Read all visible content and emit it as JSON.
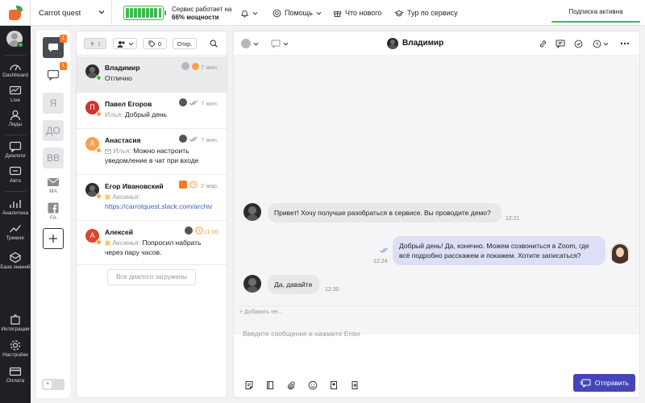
{
  "topbar": {
    "workspace": "Carrot quest",
    "service_line1": "Сервис работает на",
    "service_power": "66% мощности",
    "help": "Помощь",
    "whats_new": "Что нового",
    "tour": "Тур по сервису",
    "subscription": "Подписка активна",
    "battery_fraction": 0.66
  },
  "leftnav": {
    "items": [
      {
        "label": "Dashboard",
        "icon": "dashboard-icon"
      },
      {
        "label": "Live",
        "icon": "live-icon"
      },
      {
        "label": "Лиды",
        "icon": "leads-icon"
      },
      {
        "label": "Диалоги",
        "icon": "dialogs-icon"
      },
      {
        "label": "Авто",
        "icon": "auto-icon"
      },
      {
        "label": "Аналитика",
        "icon": "analytics-icon"
      },
      {
        "label": "Трекинг",
        "icon": "tracking-icon"
      },
      {
        "label": "База знаний",
        "icon": "knowledge-base-icon"
      },
      {
        "label": "Интеграции",
        "icon": "integrations-icon"
      },
      {
        "label": "Настройки",
        "icon": "settings-icon"
      },
      {
        "label": "Оплата",
        "icon": "payment-icon"
      }
    ]
  },
  "channels": {
    "badge1": "1",
    "badge2": "1",
    "ya": "Я",
    "do": "ДО",
    "vv": "ВВ",
    "mail_label": "MA",
    "fb_label": "FA"
  },
  "conversations": {
    "toolbar": {
      "lightning": "1",
      "tag_count": "0",
      "status": "Откр."
    },
    "items": [
      {
        "name": "Владимир",
        "time": "7 мин.",
        "preview": "Отлично",
        "initial": "",
        "avatar_color": "#2c2c2c",
        "status_color": "#3dba4e"
      },
      {
        "name": "Павел Егоров",
        "time": "7 мин.",
        "who": "Илья:",
        "preview": "Добрый день",
        "initial": "П",
        "avatar_color": "#d0342c",
        "status_color": "#f5a14a"
      },
      {
        "name": "Анастасия",
        "time": "7 мин.",
        "who": "Илья:",
        "preview": "Можно настроить уведомление в чат при входе",
        "initial": "А",
        "avatar_color": "#f5a14a",
        "status_color": "#f5a14a"
      },
      {
        "name": "Егор Ивановский",
        "time": "2 мар.",
        "who": "Аксинья:",
        "preview": "https://carrotquest.slack.com/archiv",
        "initial": "",
        "avatar_color": "#2c2c2c",
        "status_color": "#f5a14a"
      },
      {
        "name": "Алексей",
        "time": "11:06",
        "who": "Аксинья:",
        "preview": "Попросил набрать через пару часов.",
        "initial": "А",
        "avatar_color": "#e0442c",
        "status_color": "#f5a14a"
      }
    ],
    "all_loaded": "Все диалоги загружены"
  },
  "chat": {
    "user_name": "Владимир",
    "messages": [
      {
        "dir": "in",
        "text": "Привет! Хочу получше разобраться в сервисе. Вы проводите демо?",
        "time": "12:21"
      },
      {
        "dir": "out",
        "text": "Добрый день! Да, конечно. Можем созвониться в Zoom, где всё подробно расскажем и покажем. Хотите записаться?",
        "time": "12:24"
      },
      {
        "dir": "in",
        "text": "Да, давайте",
        "time": "12:30"
      }
    ],
    "add_tag": "+ Добавить тег...",
    "composer_placeholder": "Введите сообщение и нажмите Enter",
    "send": "Отправить"
  },
  "colors": {
    "accent": "#4446b8",
    "online": "#3dba4e",
    "badge": "#f47b28",
    "nav_bg": "#1f2024"
  }
}
